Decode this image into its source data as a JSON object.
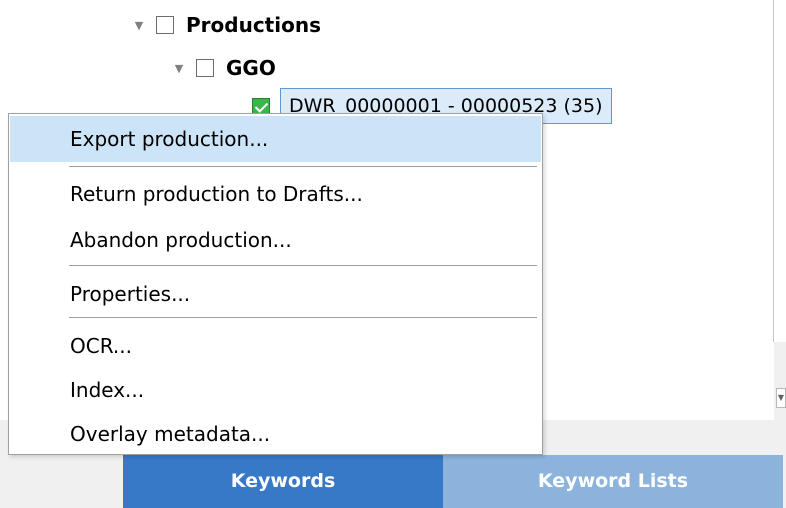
{
  "tree": {
    "root": {
      "label": "Productions",
      "checked": false,
      "expanded": true
    },
    "child": {
      "label": "GGO",
      "checked": false,
      "expanded": true
    },
    "item": {
      "label": "DWR_00000001 - 00000523 (35)",
      "checked": true
    }
  },
  "context_menu": {
    "items": [
      {
        "label": "Export production...",
        "highlighted": true
      },
      {
        "label": "Return production to Drafts..."
      },
      {
        "label": "Abandon production..."
      },
      {
        "label": "Properties..."
      },
      {
        "label": "OCR..."
      },
      {
        "label": "Index..."
      },
      {
        "label": "Overlay metadata..."
      }
    ]
  },
  "tabs": [
    {
      "label": "Keywords",
      "active": true
    },
    {
      "label": "Keyword Lists",
      "active": false
    }
  ],
  "colors": {
    "tab_active": "#3778c7",
    "tab_inactive": "#8bb3dc",
    "menu_highlight": "#cce4f7",
    "checkbox_checked": "#3bb54a",
    "selected_item_border": "#5b9bd5"
  }
}
